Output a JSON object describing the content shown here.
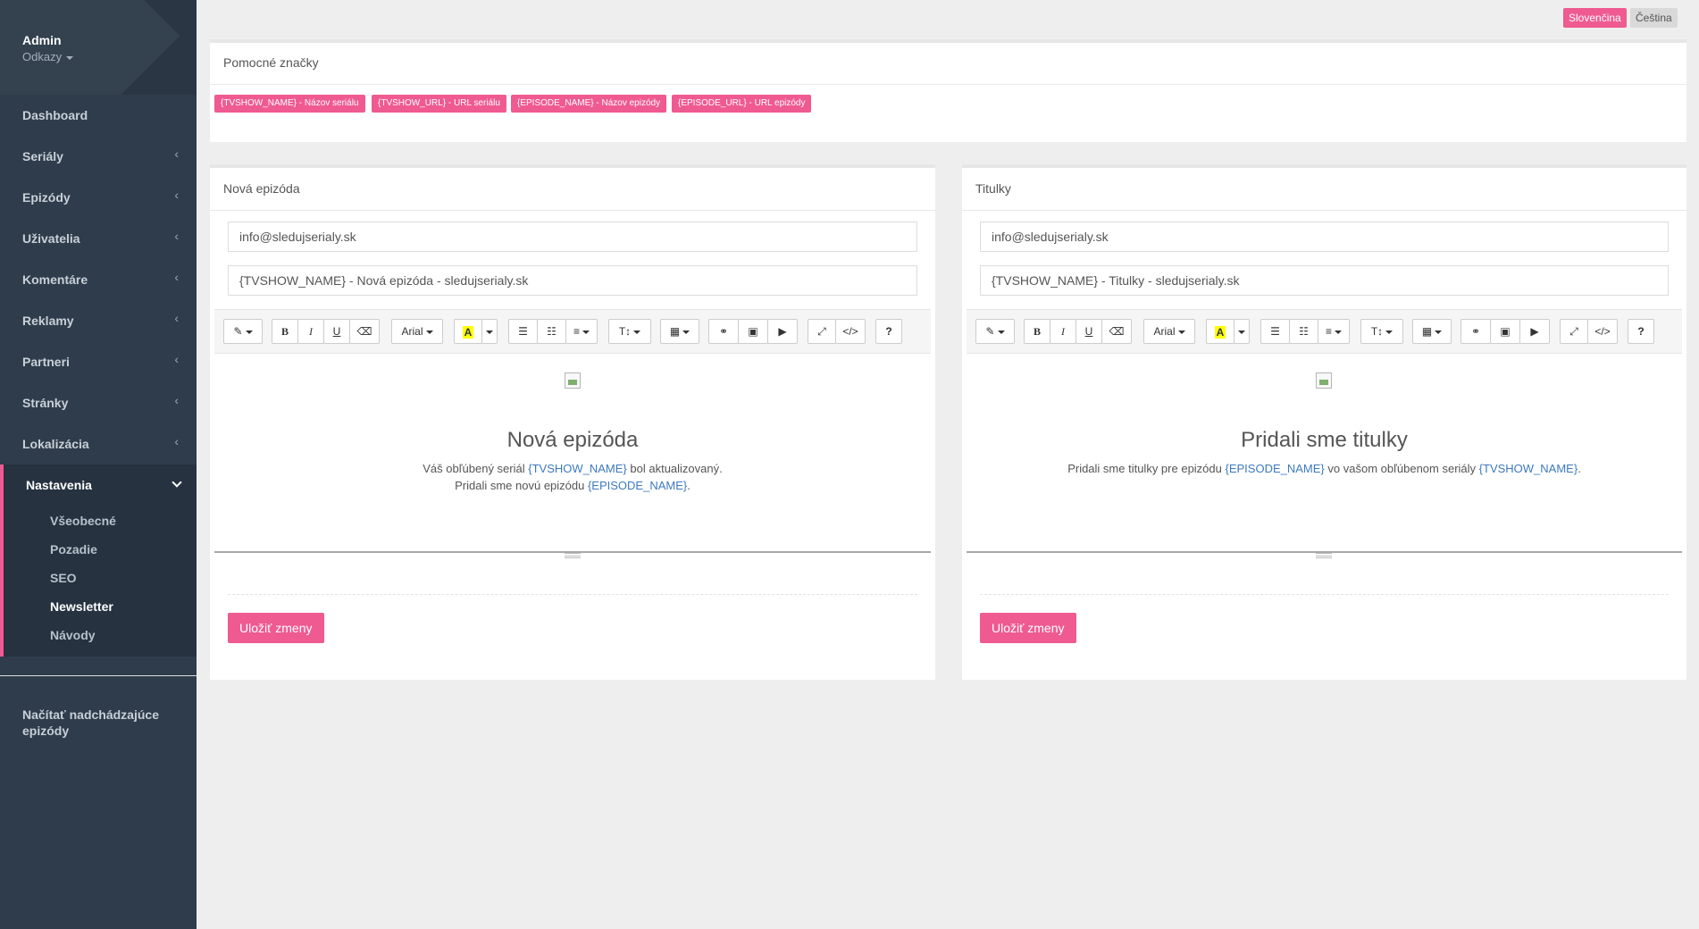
{
  "sidebar": {
    "user": {
      "name": "Admin",
      "links_label": "Odkazy"
    },
    "items": [
      {
        "label": "Dashboard",
        "has_children": false
      },
      {
        "label": "Seriály",
        "has_children": true
      },
      {
        "label": "Epizódy",
        "has_children": true
      },
      {
        "label": "Uživatelia",
        "has_children": true
      },
      {
        "label": "Komentáre",
        "has_children": true
      },
      {
        "label": "Reklamy",
        "has_children": true
      },
      {
        "label": "Partneri",
        "has_children": true
      },
      {
        "label": "Stránky",
        "has_children": true
      },
      {
        "label": "Lokalizácia",
        "has_children": true
      }
    ],
    "open_section": {
      "label": "Nastavenia",
      "children": [
        {
          "label": "Všeobecné",
          "active": false
        },
        {
          "label": "Pozadie",
          "active": false
        },
        {
          "label": "SEO",
          "active": false
        },
        {
          "label": "Newsletter",
          "active": true
        },
        {
          "label": "Návody",
          "active": false
        }
      ]
    },
    "bottom_link": "Načítať nadchádzajúce epizódy"
  },
  "languages": {
    "active": "Slovenčina",
    "other": "Čeština"
  },
  "helper_panel": {
    "title": "Pomocné značky",
    "tags": [
      "{TVSHOW_NAME} - Názov seriálu",
      "{TVSHOW_URL} - URL seriálu",
      "{EPISODE_NAME} - Názov epizódy",
      "{EPISODE_URL} - URL epizódy"
    ]
  },
  "toolbar": {
    "font": "Arial",
    "highlight_glyph": "A",
    "help": "?"
  },
  "new_episode_panel": {
    "title": "Nová epizóda",
    "sender": "info@sledujserialy.sk",
    "subject": "{TVSHOW_NAME} - Nová epizóda - sledujserialy.sk",
    "heading": "Nová epizóda",
    "line1": {
      "a": "Váš obľúbený seriál ",
      "ph": "{TVSHOW_NAME}",
      "b": " bol aktualizovaný."
    },
    "line2": {
      "a": "Pridali sme novú epizódu ",
      "ph": "{EPISODE_NAME}",
      "b": "."
    },
    "save_label": "Uložiť zmeny"
  },
  "subtitles_panel": {
    "title": "Titulky",
    "sender": "info@sledujserialy.sk",
    "subject": "{TVSHOW_NAME} - Titulky - sledujserialy.sk",
    "heading": "Pridali sme titulky",
    "line1": {
      "a": "Pridali sme titulky pre epizódu ",
      "ph": "{EPISODE_NAME}",
      "b": " vo vašom obľúbenom seriály ",
      "ph2": "{TVSHOW_NAME}",
      "c": "."
    },
    "save_label": "Uložiť zmeny"
  },
  "colors": {
    "sidebar_bg": "#2f3c4b",
    "accent": "#ef5a90",
    "link": "#3c7abf"
  }
}
